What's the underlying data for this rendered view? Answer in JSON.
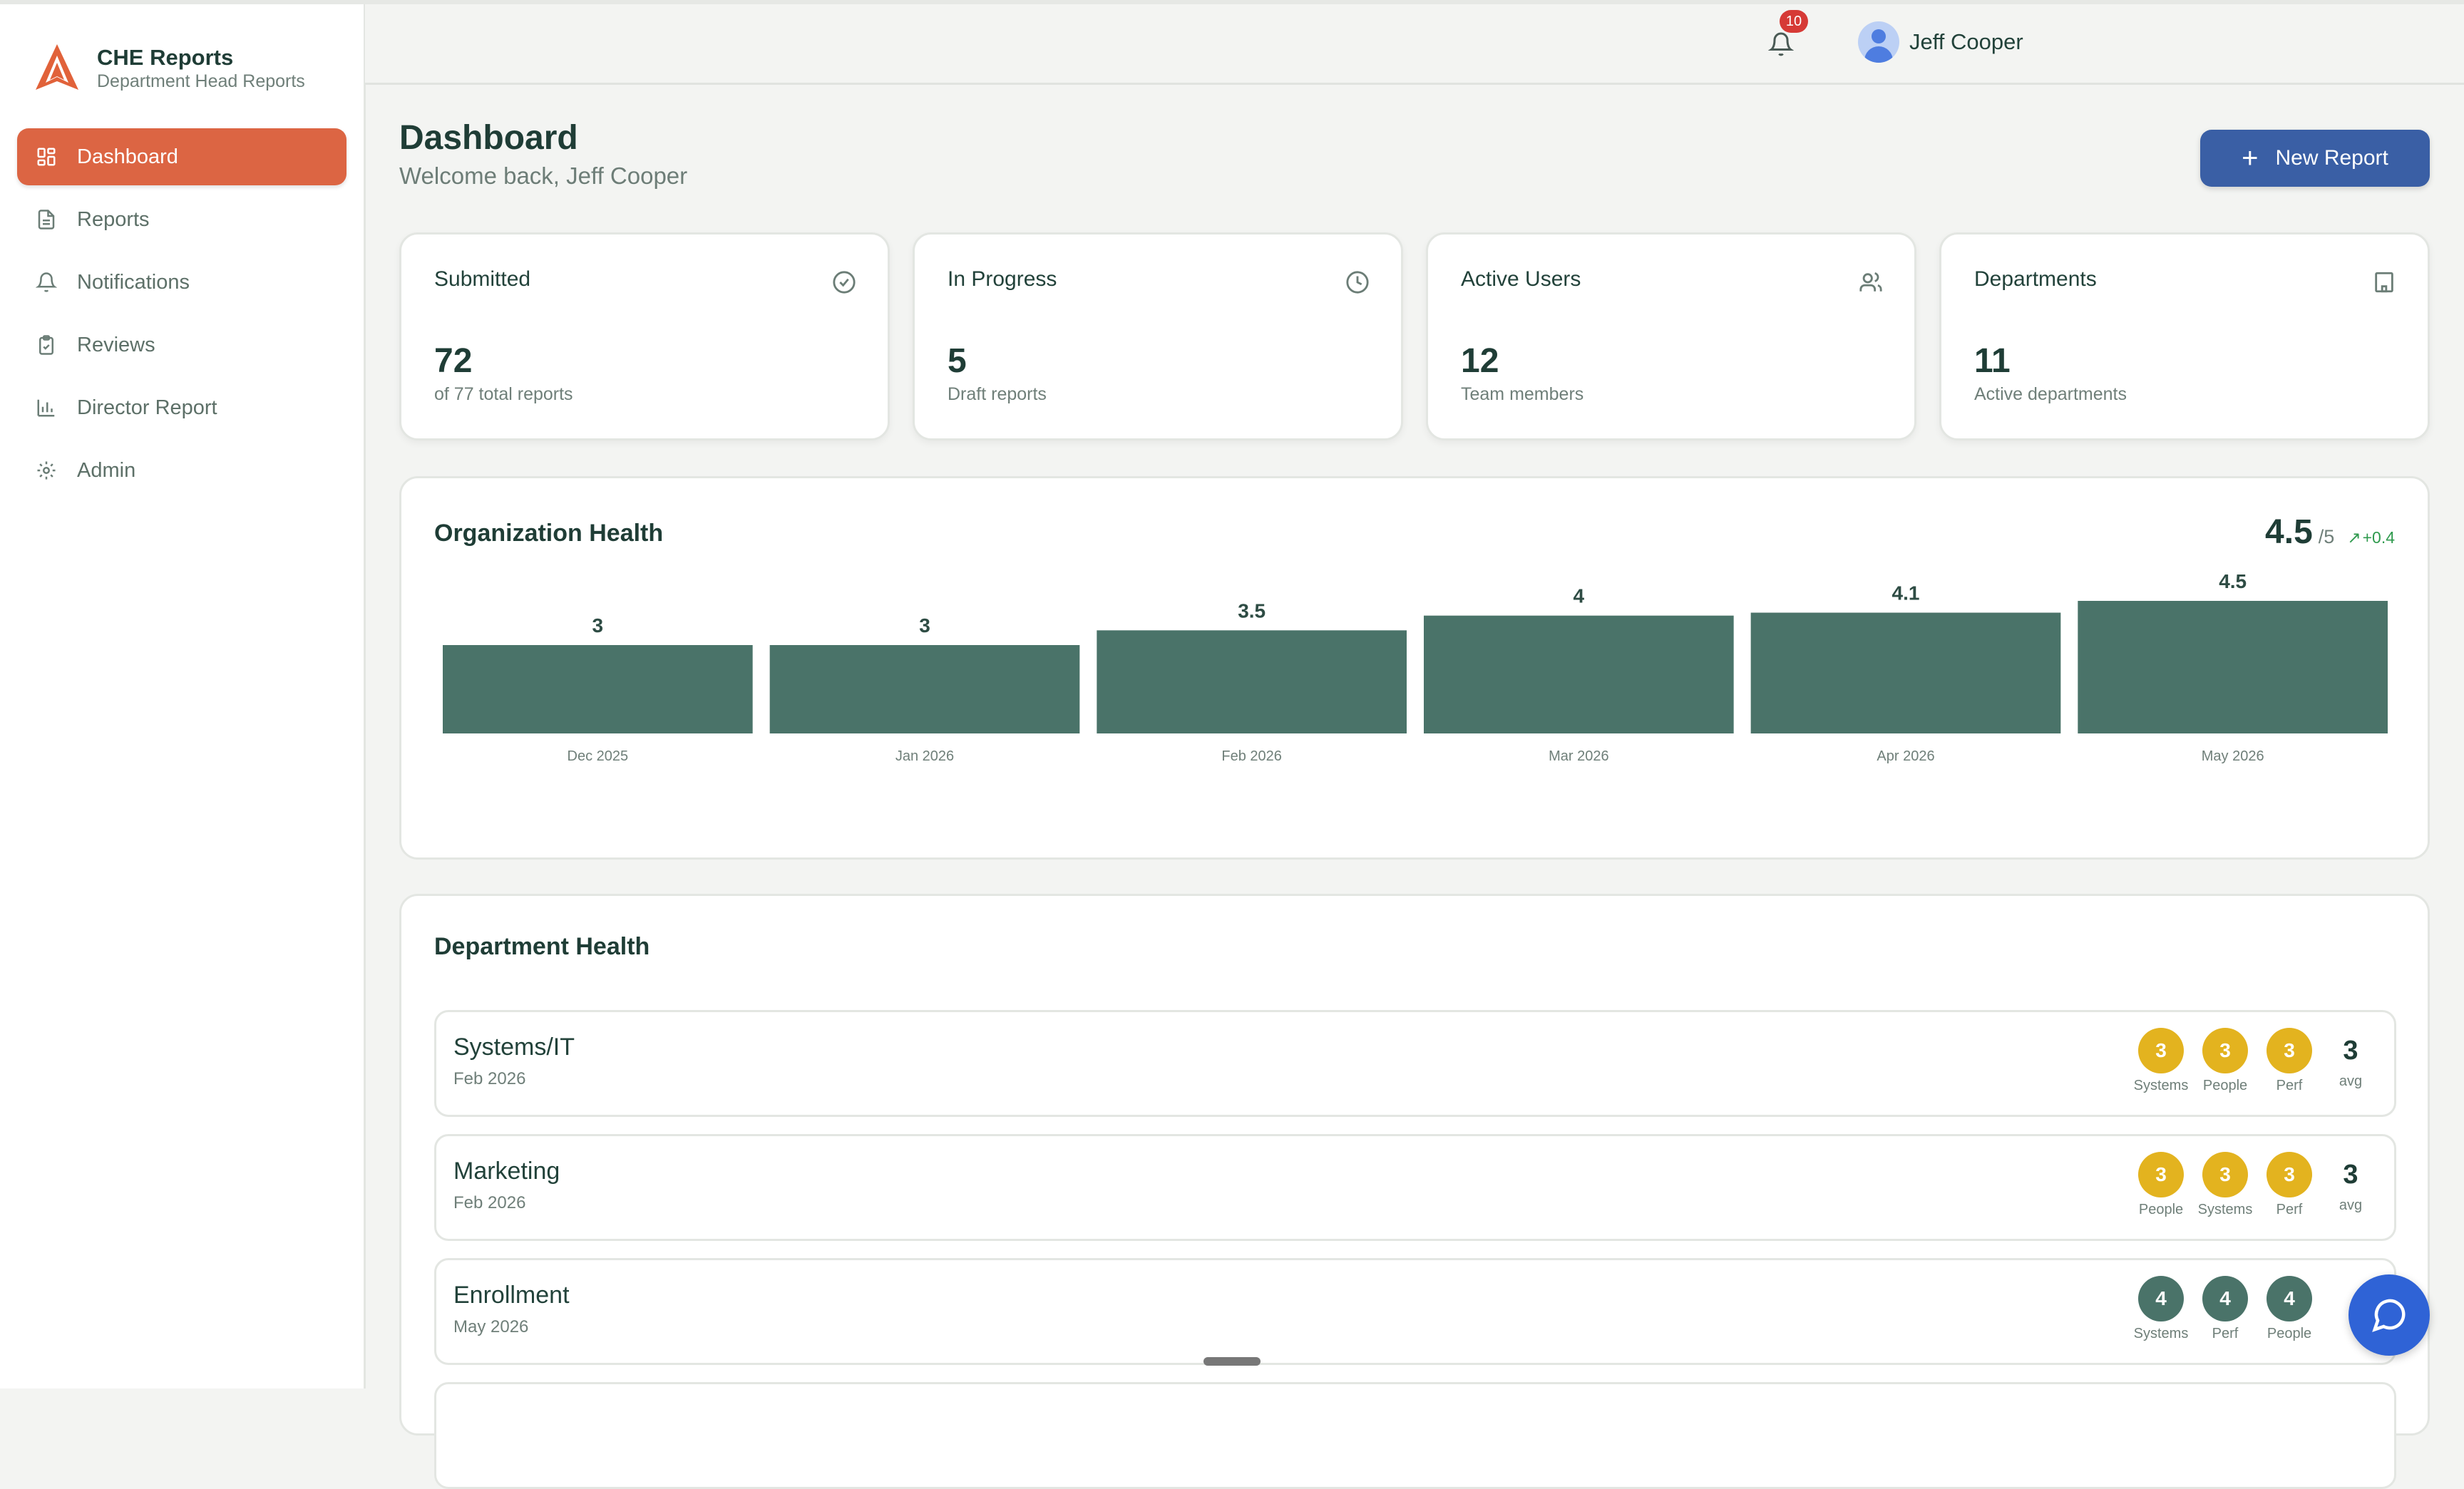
{
  "app": {
    "name": "CHE Reports",
    "subtitle": "Department Head Reports"
  },
  "sidebar": {
    "items": [
      {
        "label": "Dashboard",
        "icon": "dashboard-icon",
        "active": true
      },
      {
        "label": "Reports",
        "icon": "file-text-icon"
      },
      {
        "label": "Notifications",
        "icon": "bell-icon"
      },
      {
        "label": "Reviews",
        "icon": "clipboard-check-icon"
      },
      {
        "label": "Director Report",
        "icon": "bar-chart-icon"
      },
      {
        "label": "Admin",
        "icon": "gear-icon"
      }
    ]
  },
  "header": {
    "notifications_count": "10",
    "user_name": "Jeff Cooper"
  },
  "page": {
    "title": "Dashboard",
    "subtitle": "Welcome back, Jeff Cooper",
    "new_report_label": "New Report"
  },
  "stats": [
    {
      "label": "Submitted",
      "value": "72",
      "sub": "of 77 total reports",
      "icon": "check-circle-icon"
    },
    {
      "label": "In Progress",
      "value": "5",
      "sub": "Draft reports",
      "icon": "clock-icon"
    },
    {
      "label": "Active Users",
      "value": "12",
      "sub": "Team members",
      "icon": "users-icon"
    },
    {
      "label": "Departments",
      "value": "11",
      "sub": "Active departments",
      "icon": "building-icon"
    }
  ],
  "org_health": {
    "title": "Organization Health",
    "score": "4.5",
    "score_of": "/5",
    "trend": "+0.4"
  },
  "chart_data": {
    "type": "bar",
    "categories": [
      "Dec 2025",
      "Jan 2026",
      "Feb 2026",
      "Mar 2026",
      "Apr 2026",
      "May 2026"
    ],
    "values": [
      3,
      3,
      3.5,
      4,
      4.1,
      4.5
    ],
    "title": "Organization Health",
    "xlabel": "",
    "ylabel": "",
    "color": "#4a7369"
  },
  "dept_health": {
    "title": "Department Health",
    "rows": [
      {
        "name": "Systems/IT",
        "date": "Feb 2026",
        "scores": [
          {
            "label": "Systems",
            "value": "3"
          },
          {
            "label": "People",
            "value": "3"
          },
          {
            "label": "Perf",
            "value": "3"
          }
        ],
        "avg": "3",
        "avg_label": "avg",
        "color": "#e3b31f"
      },
      {
        "name": "Marketing",
        "date": "Feb 2026",
        "scores": [
          {
            "label": "People",
            "value": "3"
          },
          {
            "label": "Systems",
            "value": "3"
          },
          {
            "label": "Perf",
            "value": "3"
          }
        ],
        "avg": "3",
        "avg_label": "avg",
        "color": "#e3b31f"
      },
      {
        "name": "Enrollment",
        "date": "May 2026",
        "scores": [
          {
            "label": "Systems",
            "value": "4"
          },
          {
            "label": "Perf",
            "value": "4"
          },
          {
            "label": "People",
            "value": "4"
          }
        ],
        "avg": "",
        "avg_label": "",
        "color": "#4a7369"
      }
    ]
  },
  "colors": {
    "accent": "#dc6543",
    "primary_button": "#3a5fa5",
    "bar": "#4a7369",
    "chat": "#2f63d6"
  }
}
